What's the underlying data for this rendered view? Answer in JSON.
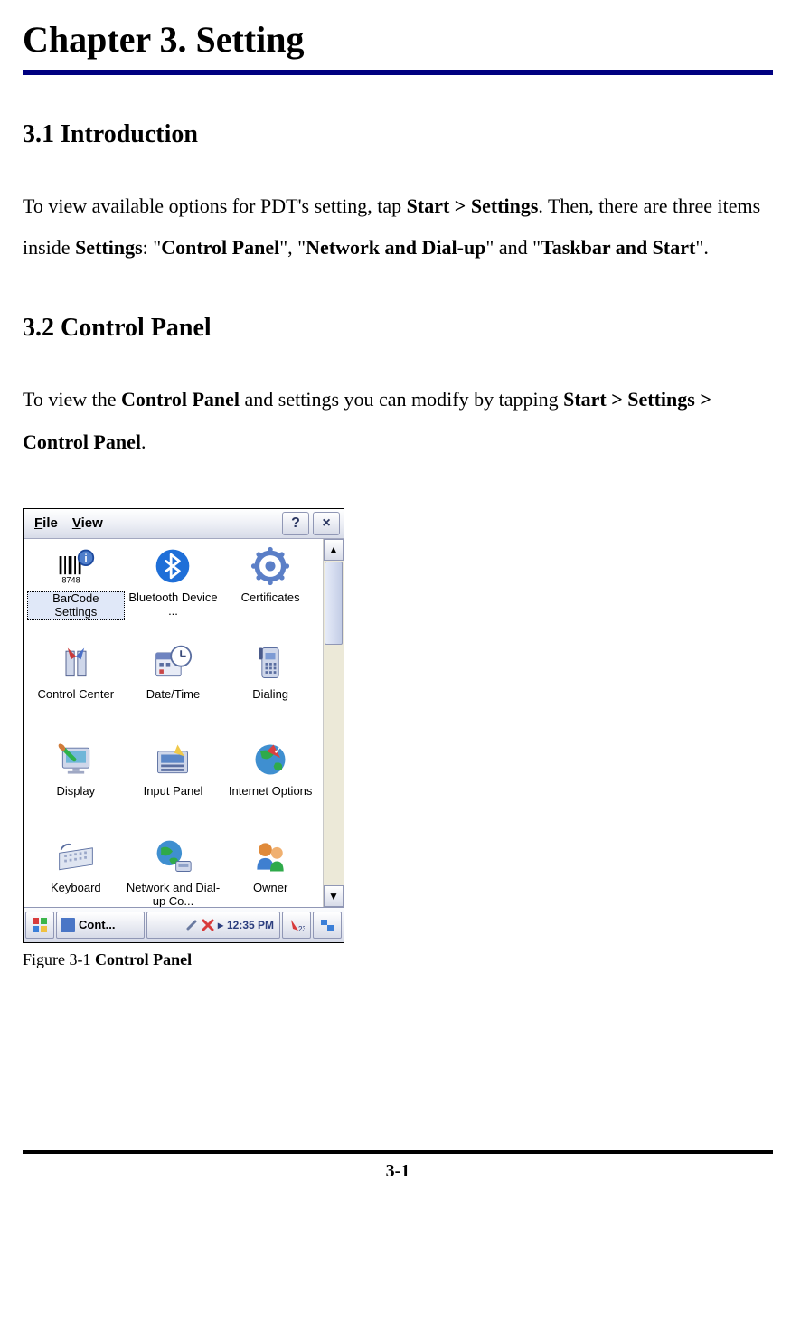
{
  "chapter_title": "Chapter 3. Setting",
  "section_31_title": "3.1 Introduction",
  "para_31": {
    "t1": "To view available options for PDT's setting, tap ",
    "b1": "Start > Settings",
    "t2": ". Then, there are three items inside ",
    "b2": "Settings",
    "t3": ": \"",
    "b3": "Control Panel",
    "t4": "\", \"",
    "b4": "Network and Dial-up",
    "t5": "\" and \"",
    "b5": "Taskbar and Start",
    "t6": "\"."
  },
  "section_32_title": "3.2 Control Panel",
  "para_32": {
    "t1": "To view the ",
    "b1": "Control Panel",
    "t2": " and settings you can modify by tapping ",
    "b2": "Start > Settings > Control Panel",
    "t3": "."
  },
  "figure": {
    "caption_prefix": "Figure 3-1 ",
    "caption_bold": "Control Panel",
    "menubar": {
      "file": "File",
      "view": "View",
      "help_btn": "?",
      "close_btn": "×"
    },
    "icons": [
      {
        "name": "barcode-settings-icon",
        "label": "BarCode Settings",
        "selected": true
      },
      {
        "name": "bluetooth-icon",
        "label": "Bluetooth Device ..."
      },
      {
        "name": "certificates-icon",
        "label": "Certificates"
      },
      {
        "name": "control-center-icon",
        "label": "Control Center"
      },
      {
        "name": "date-time-icon",
        "label": "Date/Time"
      },
      {
        "name": "dialing-icon",
        "label": "Dialing"
      },
      {
        "name": "display-icon",
        "label": "Display"
      },
      {
        "name": "input-panel-icon",
        "label": "Input Panel"
      },
      {
        "name": "internet-options-icon",
        "label": "Internet Options"
      },
      {
        "name": "keyboard-icon",
        "label": "Keyboard"
      },
      {
        "name": "network-dialup-icon",
        "label": "Network and Dial-up Co..."
      },
      {
        "name": "owner-icon",
        "label": "Owner"
      }
    ],
    "scrollbar": {
      "up": "▲",
      "down": "▼"
    },
    "taskbar": {
      "task_label": "Cont...",
      "clock": "12:35 PM"
    }
  },
  "page_number": "3-1"
}
